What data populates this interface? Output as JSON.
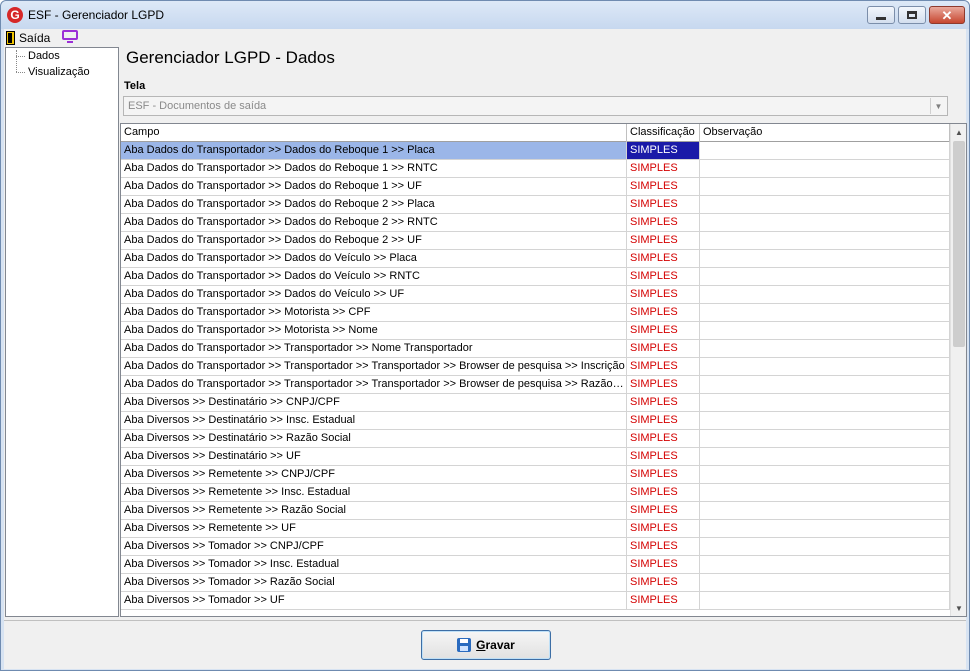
{
  "window": {
    "title": "ESF - Gerenciador LGPD",
    "icon_letter": "G"
  },
  "menu": {
    "saida_label": "Saída"
  },
  "tree": {
    "items": [
      {
        "label": "Dados"
      },
      {
        "label": "Visualização"
      }
    ]
  },
  "page": {
    "title": "Gerenciador LGPD - Dados",
    "tela_label": "Tela",
    "tela_value": "ESF - Documentos de saída"
  },
  "grid": {
    "headers": {
      "campo": "Campo",
      "classificacao": "Classificação",
      "observacao": "Observação"
    },
    "rows": [
      {
        "campo": "Aba Dados do Transportador >> Dados do Reboque 1 >> Placa",
        "classificacao": "SIMPLES",
        "observacao": "",
        "selected": true
      },
      {
        "campo": "Aba Dados do Transportador >> Dados do Reboque 1 >> RNTC",
        "classificacao": "SIMPLES",
        "observacao": ""
      },
      {
        "campo": "Aba Dados do Transportador >> Dados do Reboque 1 >> UF",
        "classificacao": "SIMPLES",
        "observacao": ""
      },
      {
        "campo": "Aba Dados do Transportador >> Dados do Reboque 2 >> Placa",
        "classificacao": "SIMPLES",
        "observacao": ""
      },
      {
        "campo": "Aba Dados do Transportador >> Dados do Reboque 2 >> RNTC",
        "classificacao": "SIMPLES",
        "observacao": ""
      },
      {
        "campo": "Aba Dados do Transportador >> Dados do Reboque 2 >> UF",
        "classificacao": "SIMPLES",
        "observacao": ""
      },
      {
        "campo": "Aba Dados do Transportador >> Dados do Veículo >> Placa",
        "classificacao": "SIMPLES",
        "observacao": ""
      },
      {
        "campo": "Aba Dados do Transportador >> Dados do Veículo >> RNTC",
        "classificacao": "SIMPLES",
        "observacao": ""
      },
      {
        "campo": "Aba Dados do Transportador >> Dados do Veículo >> UF",
        "classificacao": "SIMPLES",
        "observacao": ""
      },
      {
        "campo": "Aba Dados do Transportador >> Motorista >> CPF",
        "classificacao": "SIMPLES",
        "observacao": ""
      },
      {
        "campo": "Aba Dados do Transportador >> Motorista >> Nome",
        "classificacao": "SIMPLES",
        "observacao": ""
      },
      {
        "campo": "Aba Dados do Transportador >> Transportador >> Nome Transportador",
        "classificacao": "SIMPLES",
        "observacao": ""
      },
      {
        "campo": "Aba Dados do Transportador >> Transportador >> Transportador >> Browser de pesquisa >> Inscrição",
        "classificacao": "SIMPLES",
        "observacao": ""
      },
      {
        "campo": "Aba Dados do Transportador >> Transportador >> Transportador >> Browser de pesquisa >> Razão soc...",
        "classificacao": "SIMPLES",
        "observacao": ""
      },
      {
        "campo": "Aba Diversos >> Destinatário >> CNPJ/CPF",
        "classificacao": "SIMPLES",
        "observacao": ""
      },
      {
        "campo": "Aba Diversos >> Destinatário >> Insc. Estadual",
        "classificacao": "SIMPLES",
        "observacao": ""
      },
      {
        "campo": "Aba Diversos >> Destinatário >> Razão Social",
        "classificacao": "SIMPLES",
        "observacao": ""
      },
      {
        "campo": "Aba Diversos >> Destinatário >> UF",
        "classificacao": "SIMPLES",
        "observacao": ""
      },
      {
        "campo": "Aba Diversos >> Remetente >> CNPJ/CPF",
        "classificacao": "SIMPLES",
        "observacao": ""
      },
      {
        "campo": "Aba Diversos >> Remetente >> Insc. Estadual",
        "classificacao": "SIMPLES",
        "observacao": ""
      },
      {
        "campo": "Aba Diversos >> Remetente >> Razão Social",
        "classificacao": "SIMPLES",
        "observacao": ""
      },
      {
        "campo": "Aba Diversos >> Remetente >> UF",
        "classificacao": "SIMPLES",
        "observacao": ""
      },
      {
        "campo": "Aba Diversos >> Tomador >> CNPJ/CPF",
        "classificacao": "SIMPLES",
        "observacao": ""
      },
      {
        "campo": "Aba Diversos >> Tomador >> Insc. Estadual",
        "classificacao": "SIMPLES",
        "observacao": ""
      },
      {
        "campo": "Aba Diversos >> Tomador >> Razão Social",
        "classificacao": "SIMPLES",
        "observacao": ""
      },
      {
        "campo": "Aba Diversos >> Tomador >> UF",
        "classificacao": "SIMPLES",
        "observacao": ""
      }
    ]
  },
  "footer": {
    "gravar_label_first": "G",
    "gravar_label_rest": "ravar"
  },
  "colors": {
    "classification_text": "#d40000",
    "selected_row": "#9bb6e8",
    "selected_cell": "#1a1aa8"
  },
  "icons": [
    "app-logo-icon",
    "door-exit-icon",
    "monitor-icon",
    "save-disk-icon",
    "chevron-down-icon"
  ]
}
